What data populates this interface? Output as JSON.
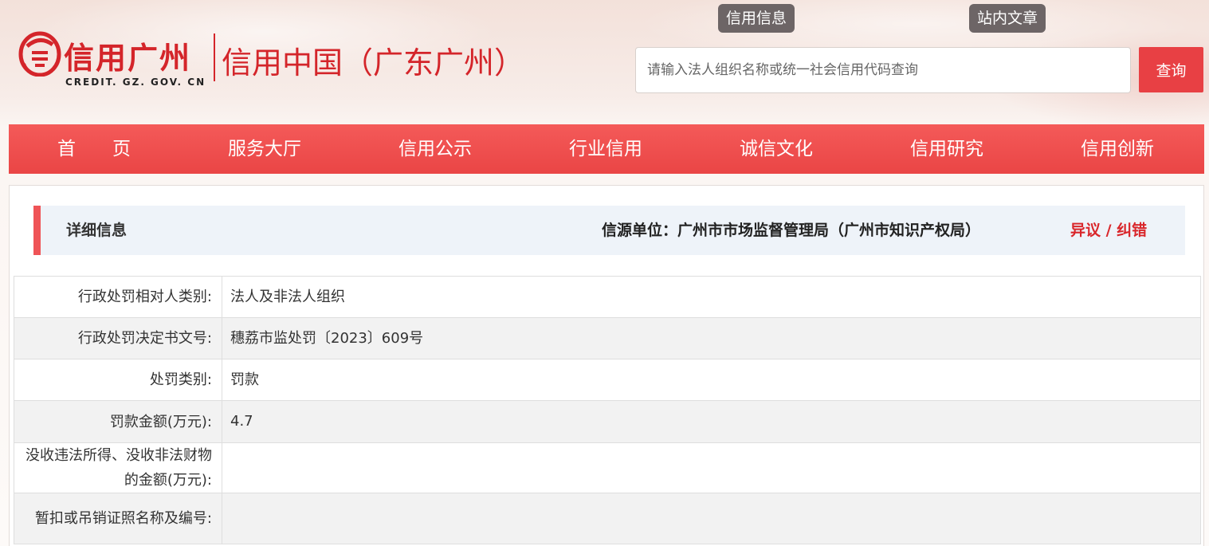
{
  "header": {
    "logo_cn": "信用广州",
    "logo_en": "CREDIT. GZ. GOV. CN",
    "subtitle": "信用中国（广东广州）",
    "top_tabs": [
      "信用信息",
      "站内文章"
    ],
    "search_placeholder": "请输入法人组织名称或统一社会信用代码查询",
    "search_button": "查询"
  },
  "nav": {
    "items": [
      "首　　页",
      "服务大厅",
      "信用公示",
      "行业信用",
      "诚信文化",
      "信用研究",
      "信用创新"
    ]
  },
  "info_bar": {
    "title": "详细信息",
    "source": "信源单位：广州市市场监督管理局（广州市知识产权局）",
    "objection": "异议 / 纠错"
  },
  "details": [
    {
      "label": "行政处罚相对人类别:",
      "value": "法人及非法人组织"
    },
    {
      "label": "行政处罚决定书文号:",
      "value": "穗荔市监处罚〔2023〕609号"
    },
    {
      "label": "处罚类别:",
      "value": "罚款"
    },
    {
      "label": "罚款金额(万元):",
      "value": "4.7"
    },
    {
      "label": "没收违法所得、没收非法财物的金额(万元):",
      "value": ""
    },
    {
      "label": "暂扣或吊销证照名称及编号:",
      "value": ""
    }
  ],
  "colors": {
    "brand_red": "#d4252a",
    "nav_red": "#ea4545",
    "tab_gray": "#6d6566"
  }
}
